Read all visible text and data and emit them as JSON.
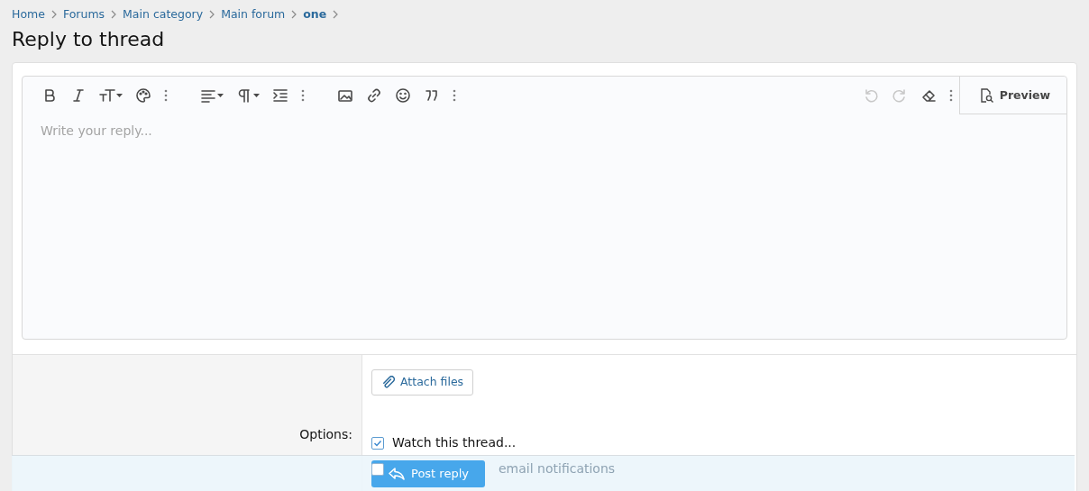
{
  "breadcrumb": [
    {
      "label": "Home",
      "current": false
    },
    {
      "label": "Forums",
      "current": false
    },
    {
      "label": "Main category",
      "current": false
    },
    {
      "label": "Main forum",
      "current": false
    },
    {
      "label": "one",
      "current": true
    }
  ],
  "title": "Reply to thread",
  "editor": {
    "toolbar_left": [
      {
        "kind": "bold",
        "dropdown": false,
        "disabled": false
      },
      {
        "kind": "italic",
        "dropdown": false,
        "disabled": false
      },
      {
        "kind": "font-size",
        "dropdown": true,
        "disabled": false
      },
      {
        "kind": "palette",
        "dropdown": false,
        "disabled": false
      },
      {
        "kind": "more",
        "dropdown": false,
        "disabled": false
      },
      {
        "kind": "align",
        "dropdown": true,
        "disabled": false
      },
      {
        "kind": "paragraph",
        "dropdown": true,
        "disabled": false
      },
      {
        "kind": "indent",
        "dropdown": false,
        "disabled": false
      },
      {
        "kind": "more",
        "dropdown": false,
        "disabled": false
      },
      {
        "kind": "image",
        "dropdown": false,
        "disabled": false
      },
      {
        "kind": "link",
        "dropdown": false,
        "disabled": false
      },
      {
        "kind": "smiley",
        "dropdown": false,
        "disabled": false
      },
      {
        "kind": "quote",
        "dropdown": false,
        "disabled": false
      },
      {
        "kind": "more",
        "dropdown": false,
        "disabled": false
      }
    ],
    "toolbar_right": [
      {
        "kind": "undo",
        "dropdown": false,
        "disabled": true
      },
      {
        "kind": "redo",
        "dropdown": false,
        "disabled": true
      },
      {
        "kind": "eraser",
        "dropdown": false,
        "disabled": false
      },
      {
        "kind": "more",
        "dropdown": false,
        "disabled": false
      }
    ],
    "preview_button": "Preview",
    "placeholder": "Write your reply..."
  },
  "attach_button": "Attach files",
  "options": {
    "label": "Options:",
    "items": [
      {
        "label": "Watch this thread...",
        "checked": true
      },
      {
        "label": "email notifications",
        "checked": false
      }
    ]
  },
  "submit_button": "Post reply"
}
